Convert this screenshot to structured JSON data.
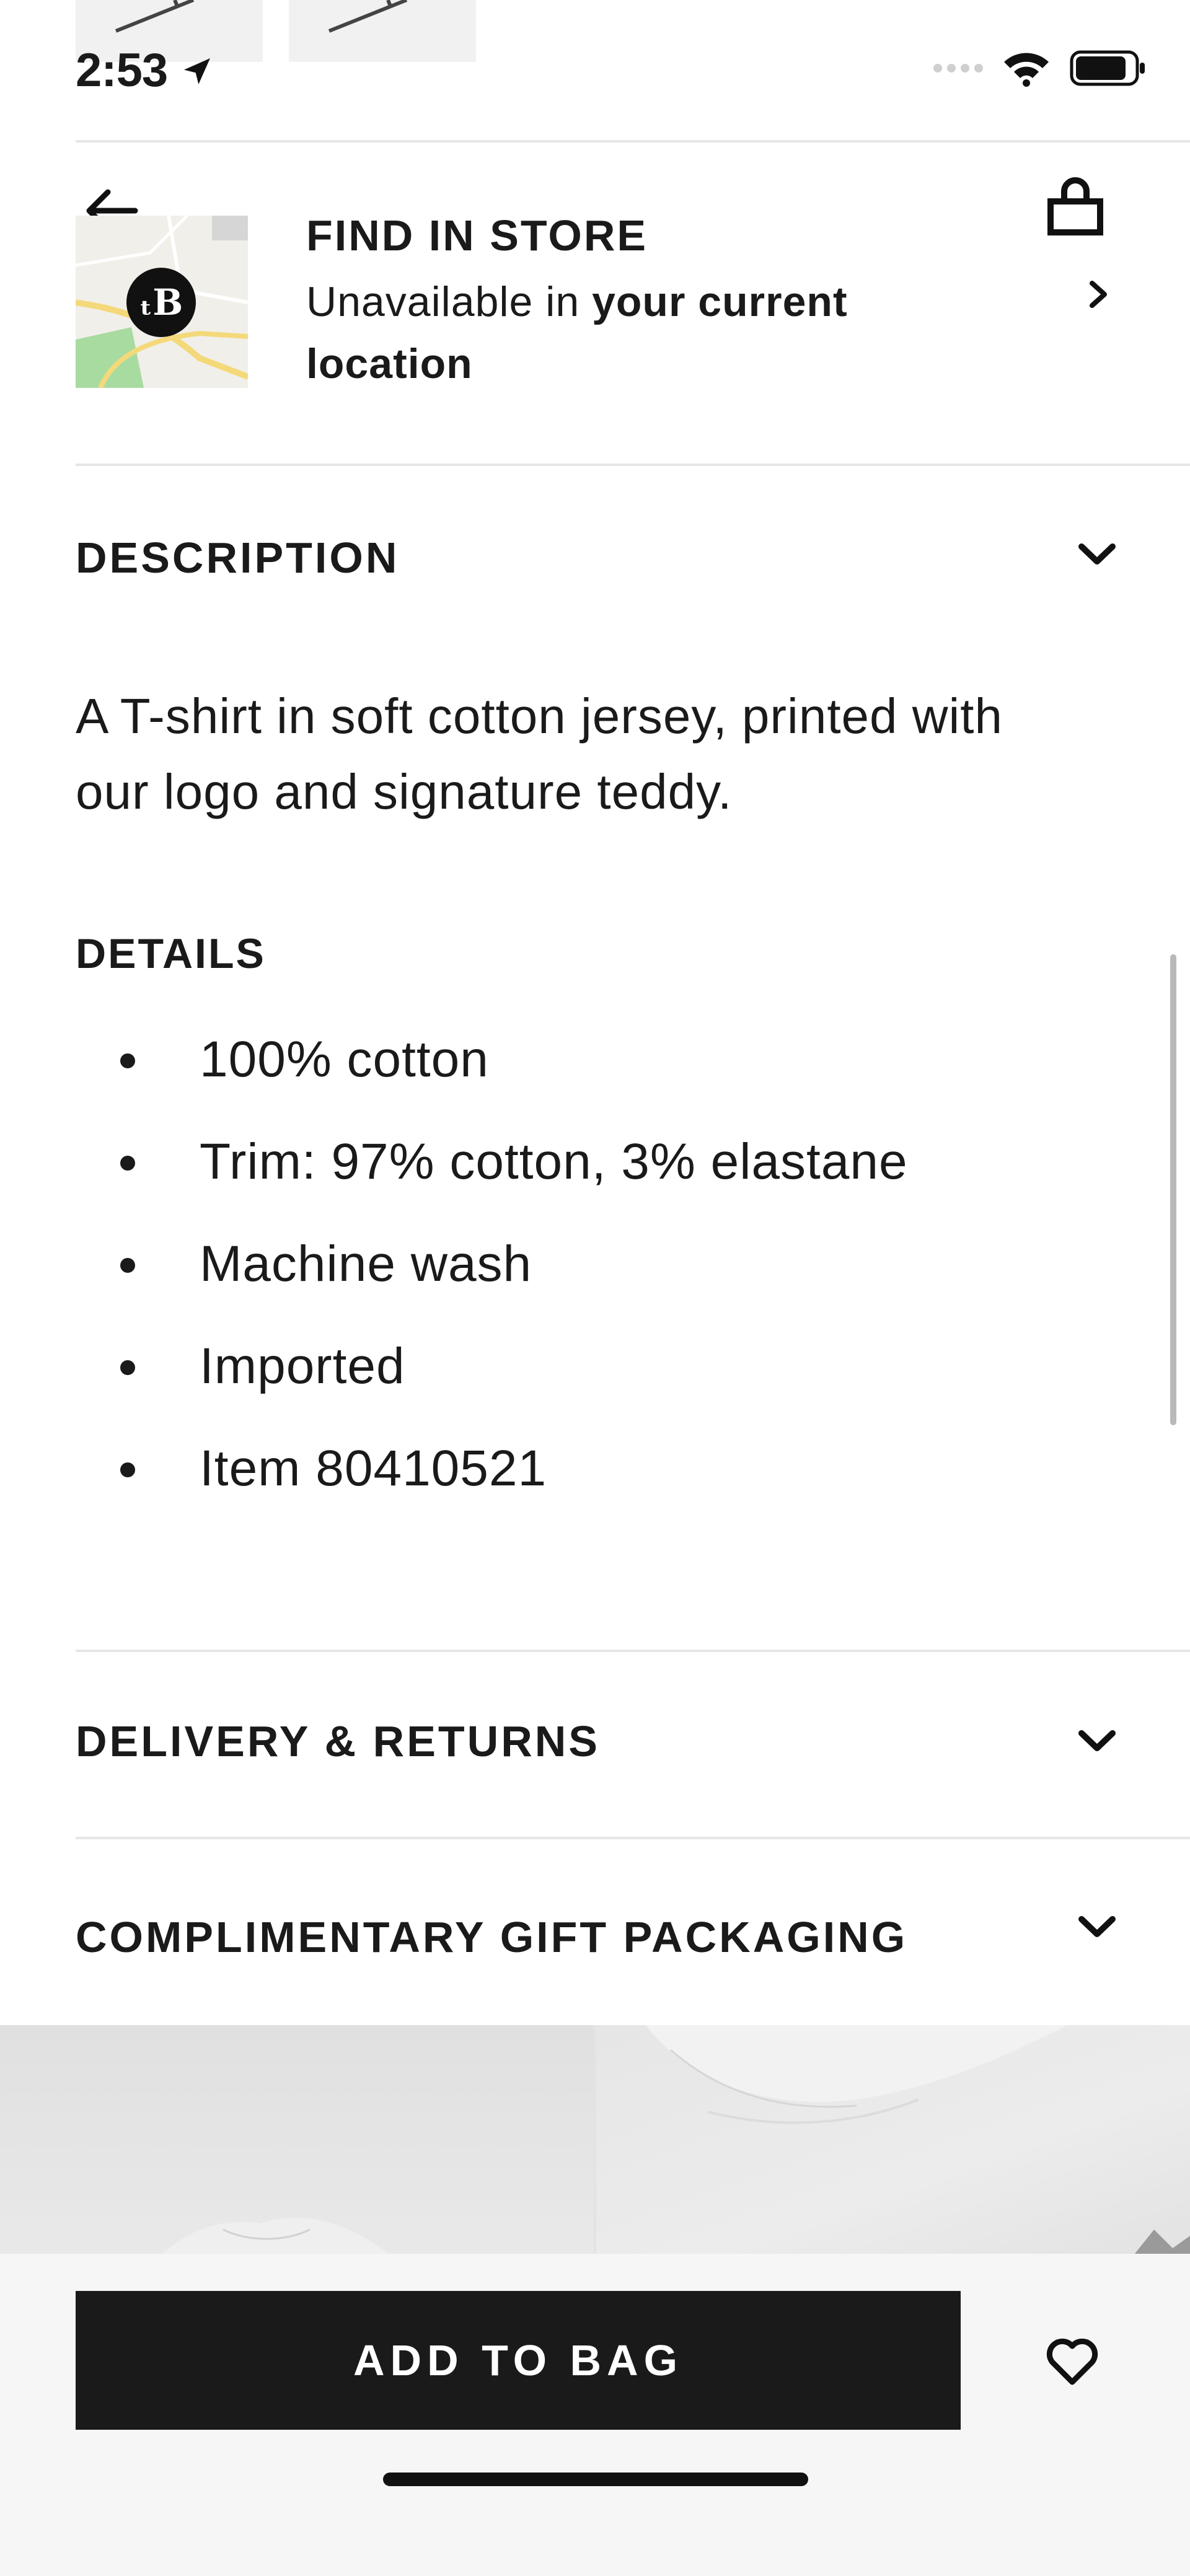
{
  "status_bar": {
    "time": "2:53",
    "icons": [
      "location-arrow-icon",
      "signal-icon",
      "wifi-icon",
      "battery-icon"
    ]
  },
  "header": {
    "back_icon": "arrow-left-icon",
    "bag_icon": "shopping-bag-icon"
  },
  "find_in_store": {
    "title": "FIND IN STORE",
    "status_prefix": "Unavailable in ",
    "status_bold_1": "your current",
    "status_bold_2": "location",
    "map_icon": "burberry-tb-logo"
  },
  "sections": {
    "description": {
      "title": "DESCRIPTION",
      "text": "A T-shirt in soft cotton jersey, printed with our logo and signature teddy.",
      "details_title": "DETAILS",
      "details": [
        "100% cotton",
        "Trim: 97% cotton, 3% elastane",
        "Machine wash",
        "Imported",
        "Item 80410521"
      ]
    },
    "delivery": {
      "title": "DELIVERY & RETURNS"
    },
    "gift": {
      "title": "COMPLIMENTARY GIFT PACKAGING"
    }
  },
  "actions": {
    "add_to_bag": "ADD TO BAG",
    "wishlist_icon": "heart-icon"
  },
  "colors": {
    "primary": "#1a1a1a",
    "background": "#ffffff",
    "divider": "#e6e6e6",
    "bottom_bar": "#f6f6f6"
  }
}
